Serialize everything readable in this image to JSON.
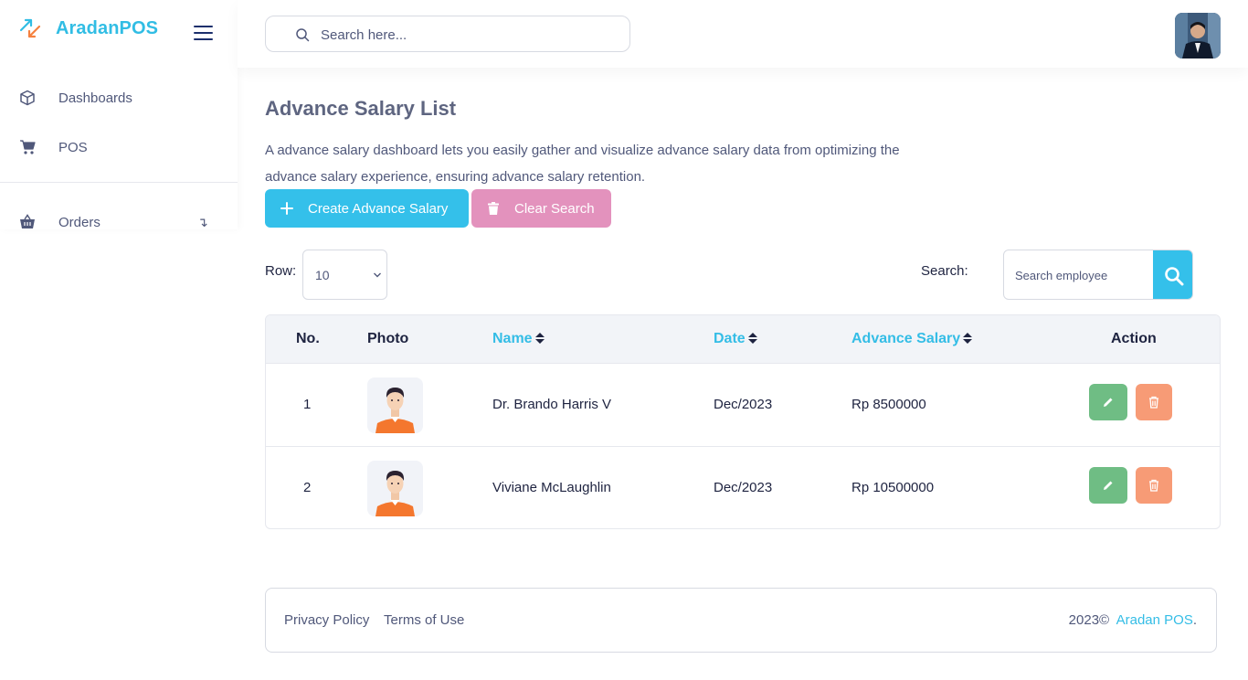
{
  "sidebar": {
    "brand": "AradanPOS",
    "items": [
      {
        "label": "Dashboards",
        "icon": "cube-icon"
      },
      {
        "label": "POS",
        "icon": "cart-icon"
      },
      {
        "label": "Orders",
        "icon": "basket-icon",
        "arrow": "↴"
      }
    ]
  },
  "topbar": {
    "search_placeholder": "Search here..."
  },
  "main": {
    "title": "Advance Salary List",
    "description": "A advance salary dashboard lets you easily gather and visualize advance salary data from optimizing the advance salary experience, ensuring advance salary retention.",
    "create_label": "Create Advance Salary",
    "clear_label": "Clear Search",
    "row_label": "Row:",
    "row_value": "10",
    "search_label": "Search:",
    "search_placeholder": "Search employee"
  },
  "table": {
    "headers": {
      "no": "No.",
      "photo": "Photo",
      "name": "Name",
      "date": "Date",
      "salary": "Advance Salary",
      "action": "Action"
    },
    "rows": [
      {
        "no": "1",
        "name": "Dr. Brando Harris V",
        "date": "Dec/2023",
        "salary": "Rp 8500000"
      },
      {
        "no": "2",
        "name": "Viviane McLaughlin",
        "date": "Dec/2023",
        "salary": "Rp 10500000"
      }
    ]
  },
  "footer": {
    "privacy": "Privacy Policy",
    "terms": "Terms of Use",
    "copyright": "2023©",
    "brand": "Aradan POS",
    "period": "."
  },
  "colors": {
    "accent": "#34c0ea",
    "clear": "#e392bd",
    "edit": "#6fbd84",
    "delete": "#f79b76",
    "brand_orange": "#f5813f"
  }
}
